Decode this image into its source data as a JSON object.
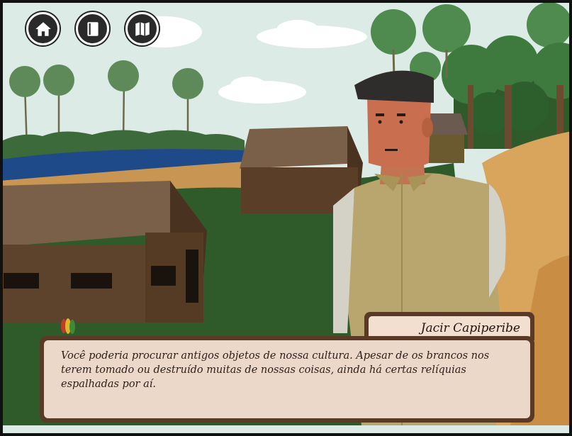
{
  "hud": {
    "buttons": [
      {
        "icon": "home-icon"
      },
      {
        "icon": "book-icon"
      },
      {
        "icon": "map-icon"
      }
    ]
  },
  "dialog": {
    "speaker": "Jacir Capiperibe",
    "text": "Você poderia procurar antigos objetos de nossa cultura. Apesar de os brancos nos terem tomado ou destruído muitas de nossas coisas, ainda há certas relíquias espalhadas por aí."
  },
  "colors": {
    "sky": "#dcebe6",
    "grass": "#2f5a2a",
    "river": "#1f4a8a",
    "path": "#d9a45c",
    "hut_roof": "#7a6048",
    "hut_wall": "#5a3e28",
    "dialog_frame": "#5a3a26",
    "dialog_bg": "#f6e4d6"
  }
}
